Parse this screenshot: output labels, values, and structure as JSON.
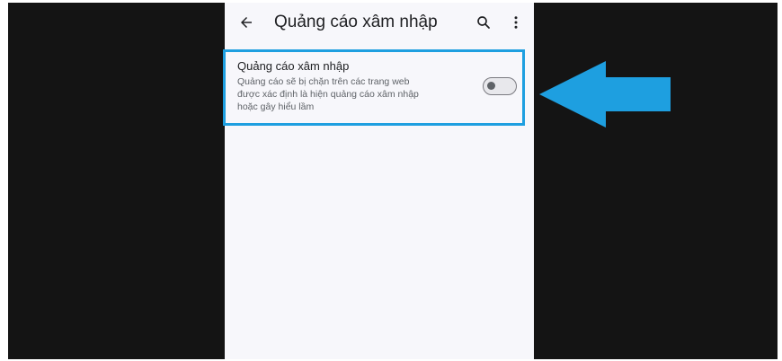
{
  "appbar": {
    "title": "Quảng cáo xâm nhập",
    "back_icon": "arrow-back-icon",
    "search_icon": "search-icon",
    "more_icon": "more-vert-icon"
  },
  "setting": {
    "title": "Quảng cáo xâm nhập",
    "description_lines": [
      "Quảng cáo sẽ bị chặn trên các trang web",
      "được xác định là hiện quảng cáo xâm nhập",
      "hoặc gây hiểu lầm"
    ],
    "toggle_state": "off"
  },
  "colors": {
    "highlight": "#1e9fe0",
    "background_dark": "#141414",
    "screen": "#f7f7fb"
  }
}
